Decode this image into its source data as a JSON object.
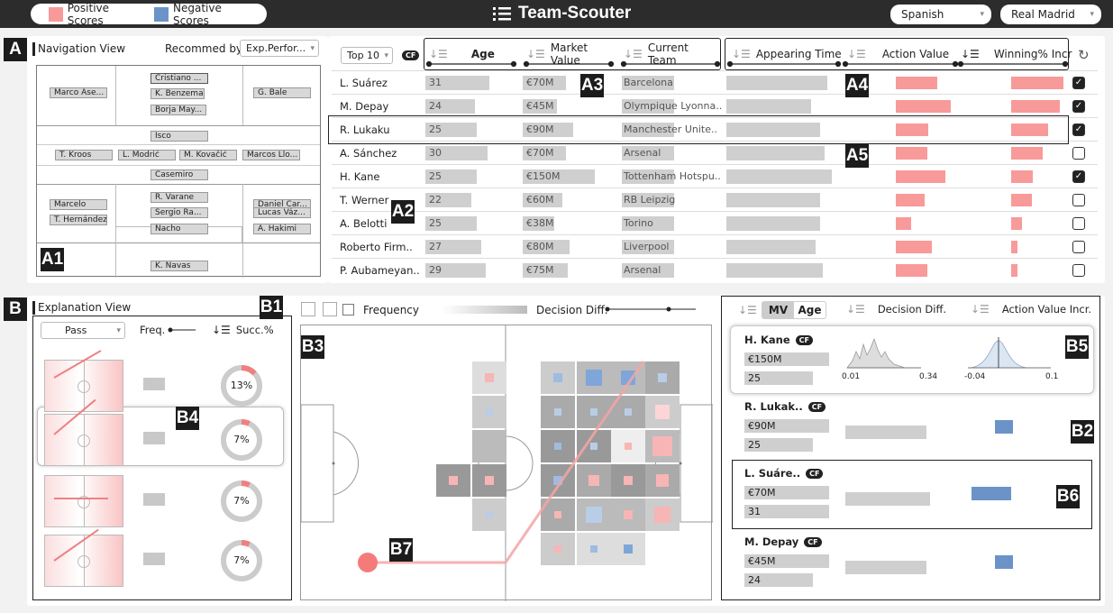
{
  "header": {
    "title": "Team-Scouter",
    "legend_positive": "Positive Scores",
    "legend_negative": "Negative Scores",
    "language": "Spanish",
    "team": "Real Madrid",
    "colors": {
      "positive": "#f89a9a",
      "negative": "#6b93c8",
      "topbar": "#2c2c2c"
    }
  },
  "labels": {
    "A": "A",
    "A1": "A1",
    "A2": "A2",
    "A3": "A3",
    "A4": "A4",
    "A5": "A5",
    "B": "B",
    "B1": "B1",
    "B2": "B2",
    "B3": "B3",
    "B4": "B4",
    "B5": "B5",
    "B6": "B6",
    "B7": "B7"
  },
  "navigation": {
    "title": "Navigation View",
    "recommend_label": "Recommed by:",
    "recommend_value": "Exp.Perfor...",
    "players": [
      "Cristiano ...",
      "K. Benzema",
      "Borja May...",
      "Marco Ase...",
      "G. Bale",
      "Isco",
      "T. Kroos",
      "L. Modrić",
      "M. Kovačić",
      "Marcos Llo...",
      "Casemiro",
      "Marcelo",
      "T. Hernández",
      "R. Varane",
      "Sergio Ra...",
      "Nacho",
      "Daniel Car...",
      "Lucas Váz...",
      "A. Hakimi",
      "K. Navas"
    ]
  },
  "table": {
    "top_select": "Top 10",
    "cf": "CF",
    "columns": [
      "Age",
      "Market Value",
      "Current Team",
      "Appearing Time",
      "Action Value",
      "Winning% Incr"
    ],
    "rows": [
      {
        "name": "L. Suárez",
        "age": "31",
        "value": "€70M",
        "team": "Barcelona",
        "checked": true,
        "appearing": 0.86,
        "action": 0.42,
        "winning": 0.85
      },
      {
        "name": "M. Depay",
        "age": "24",
        "value": "€45M",
        "team": "Olympique Lyonna..",
        "checked": true,
        "appearing": 0.72,
        "action": 0.55,
        "winning": 0.8
      },
      {
        "name": "R. Lukaku",
        "age": "25",
        "value": "€90M",
        "team": "Manchester Unite..",
        "checked": true,
        "appearing": 0.8,
        "action": 0.33,
        "winning": 0.6
      },
      {
        "name": "A. Sánchez",
        "age": "30",
        "value": "€70M",
        "team": "Arsenal",
        "checked": false,
        "appearing": 0.84,
        "action": 0.32,
        "winning": 0.52
      },
      {
        "name": "H. Kane",
        "age": "25",
        "value": "€150M",
        "team": "Tottenham Hotspu..",
        "checked": true,
        "appearing": 0.9,
        "action": 0.5,
        "winning": 0.36
      },
      {
        "name": "T. Werner",
        "age": "22",
        "value": "€60M",
        "team": "RB Leipzig",
        "checked": false,
        "appearing": 0.8,
        "action": 0.29,
        "winning": 0.34
      },
      {
        "name": "A. Belotti",
        "age": "25",
        "value": "€38M",
        "team": "Torino",
        "checked": false,
        "appearing": 0.8,
        "action": 0.15,
        "winning": 0.18
      },
      {
        "name": "Roberto Firm..",
        "age": "27",
        "value": "€80M",
        "team": "Liverpool",
        "checked": false,
        "appearing": 0.76,
        "action": 0.36,
        "winning": 0.1
      },
      {
        "name": "P. Aubameyan..",
        "age": "29",
        "value": "€75M",
        "team": "Arsenal",
        "checked": false,
        "appearing": 0.82,
        "action": 0.32,
        "winning": 0.1
      }
    ]
  },
  "explanation": {
    "title": "Explanation View",
    "action_select": "Pass",
    "freq_label": "Freq.",
    "succ_label": "Succ.%",
    "items": [
      {
        "succ": "13%",
        "pct": 0.13
      },
      {
        "succ": "7%",
        "pct": 0.07
      },
      {
        "succ": "7%",
        "pct": 0.07
      },
      {
        "succ": "7%",
        "pct": 0.07
      }
    ]
  },
  "heatmap": {
    "frequency_label": "Frequency",
    "decision_diff_label": "Decision Diff."
  },
  "comparison": {
    "tab_mv": "MV",
    "tab_age": "Age",
    "decision_diff": "Decision Diff.",
    "action_value_incr": "Action Value Incr.",
    "dist_ticks_left": [
      "0.01",
      "0.34"
    ],
    "dist_ticks_right": [
      "-0.04",
      "0.1"
    ],
    "players": [
      {
        "name": "H. Kane",
        "cf": "CF",
        "value": "€150M",
        "age": "25"
      },
      {
        "name": "R. Lukak..",
        "cf": "CF",
        "value": "€90M",
        "age": "25"
      },
      {
        "name": "L. Suáre..",
        "cf": "CF",
        "value": "€70M",
        "age": "31"
      },
      {
        "name": "M. Depay",
        "cf": "CF",
        "value": "€45M",
        "age": "24"
      }
    ]
  }
}
